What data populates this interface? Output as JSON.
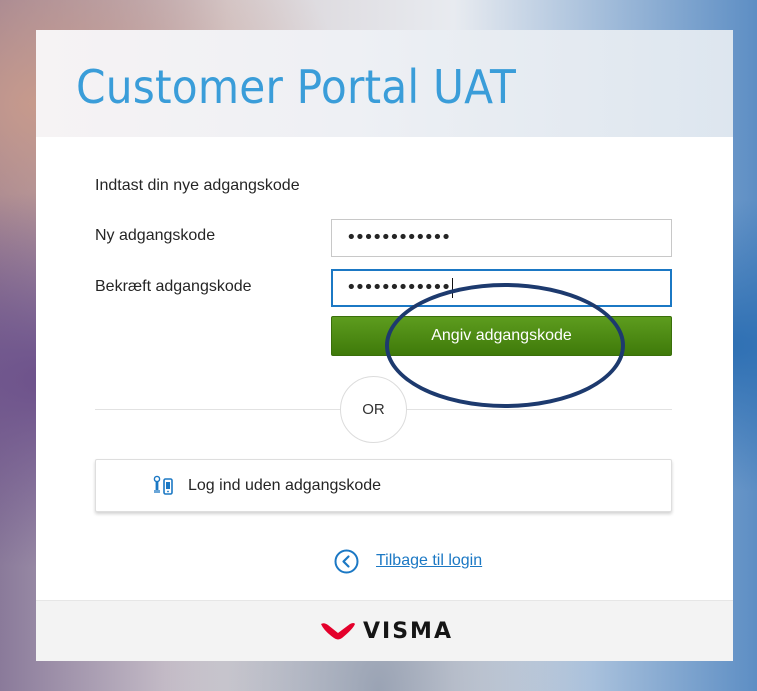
{
  "portal": {
    "title": "Customer Portal UAT"
  },
  "form": {
    "instruction": "Indtast din nye adgangskode",
    "new_password_label": "Ny adgangskode",
    "new_password_value": "••••••••••••",
    "confirm_password_label": "Bekræft adgangskode",
    "confirm_password_value": "••••••••••••",
    "submit_label": "Angiv adgangskode"
  },
  "divider": {
    "text": "OR"
  },
  "passwordless": {
    "label": "Log ind uden adgangskode",
    "icon": "passwordless-key-icon"
  },
  "back": {
    "label": "Tilbage til login",
    "icon": "chevron-left-circle-icon"
  },
  "footer": {
    "brand": "VISMA",
    "brand_color": "#e4002b"
  },
  "colors": {
    "title": "#3a9dd9",
    "button": "#4a8a10",
    "link": "#1b78c4",
    "annotation": "#1d3a6e"
  }
}
